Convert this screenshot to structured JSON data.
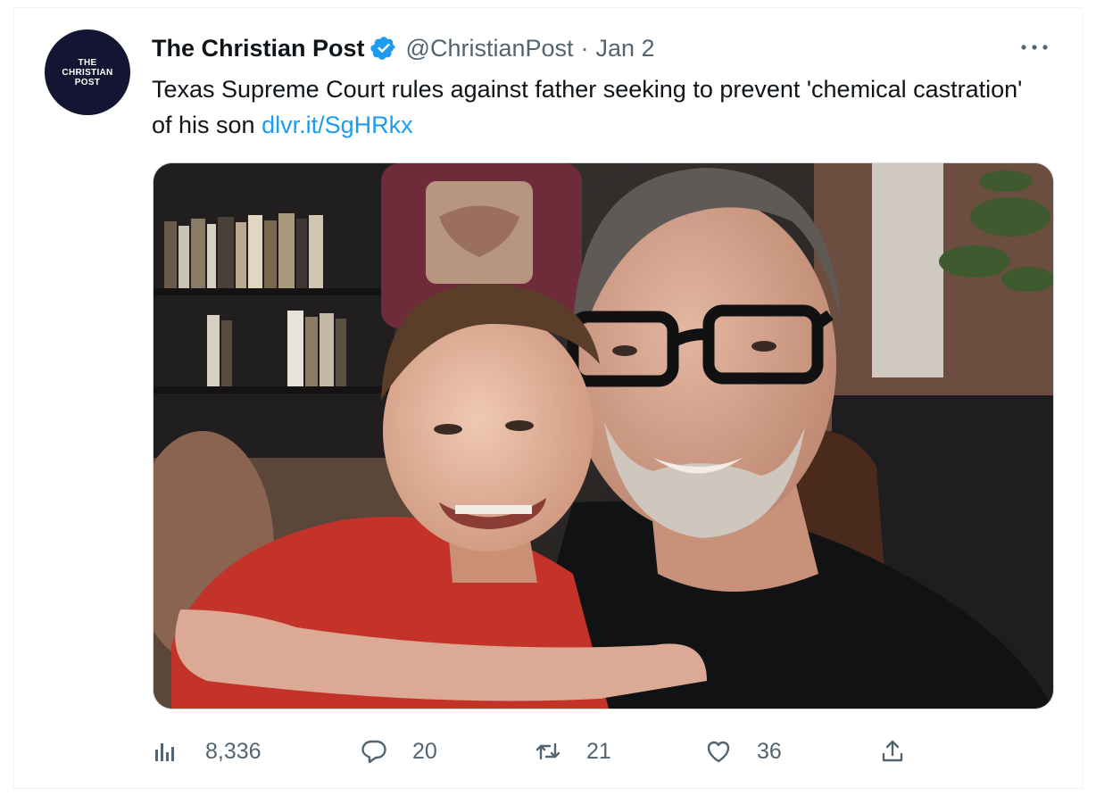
{
  "tweet": {
    "author": {
      "avatar_text": [
        "THE",
        "CHRISTIAN",
        "POST"
      ],
      "name": "The Christian Post",
      "verified_icon": "verified-badge-icon",
      "handle": "@ChristianPost",
      "separator": "·",
      "date": "Jan 2"
    },
    "more_icon": "more-dots-icon",
    "text": "Texas Supreme Court rules against father seeking to prevent 'chemical castration' of his son ",
    "link": "dlvr.it/SgHRkx",
    "media": {
      "kind": "photo",
      "content": "father-and-son-photo"
    },
    "actions": {
      "views": {
        "icon": "views-chart-icon",
        "count": "8,336"
      },
      "reply": {
        "icon": "reply-bubble-icon",
        "count": "20"
      },
      "retweet": {
        "icon": "retweet-icon",
        "count": "21"
      },
      "like": {
        "icon": "heart-icon",
        "count": "36"
      },
      "share": {
        "icon": "share-upload-icon"
      }
    }
  },
  "colors": {
    "text_primary": "#0f1419",
    "text_secondary": "#536471",
    "link": "#1d9bf0",
    "verified": "#1d9bf0",
    "avatar_bg": "#141433",
    "border": "#eff3f4"
  }
}
